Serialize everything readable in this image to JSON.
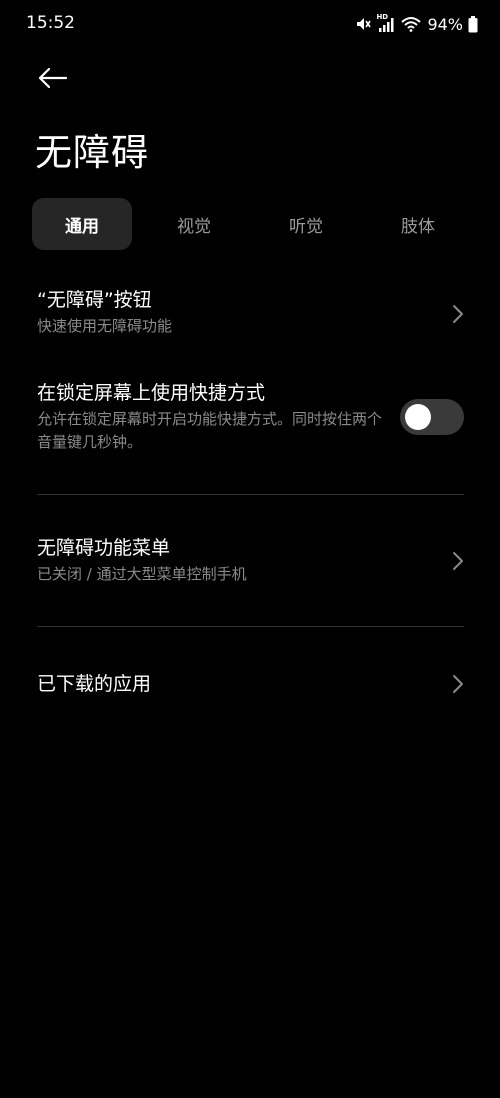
{
  "status_bar": {
    "time": "15:52",
    "battery": "94%",
    "icons": [
      "mute-icon",
      "hd-signal-icon",
      "wifi-icon",
      "battery-icon"
    ],
    "hd_label": "HD"
  },
  "header": {
    "back_icon": "arrow-left-icon",
    "title": "无障碍"
  },
  "tabs": [
    {
      "label": "通用",
      "active": true
    },
    {
      "label": "视觉",
      "active": false
    },
    {
      "label": "听觉",
      "active": false
    },
    {
      "label": "肢体",
      "active": false
    }
  ],
  "settings": {
    "accessibility_button": {
      "title": "“无障碍”按钮",
      "subtitle": "快速使用无障碍功能",
      "icon": "chevron-right-icon"
    },
    "lockscreen_shortcut": {
      "title": "在锁定屏幕上使用快捷方式",
      "subtitle": "允许在锁定屏幕时开启功能快捷方式。同时按住两个音量键几秒钟。",
      "enabled": false
    },
    "accessibility_menu": {
      "title": "无障碍功能菜单",
      "subtitle": "已关闭 / 通过大型菜单控制手机",
      "icon": "chevron-right-icon"
    },
    "downloaded_apps": {
      "title": "已下载的应用",
      "icon": "chevron-right-icon"
    }
  },
  "colors": {
    "background": "#000000",
    "text_primary": "#ffffff",
    "text_secondary": "#8a8a8a",
    "tab_active_bg": "#262626",
    "toggle_off_track": "#3a3a3a"
  }
}
